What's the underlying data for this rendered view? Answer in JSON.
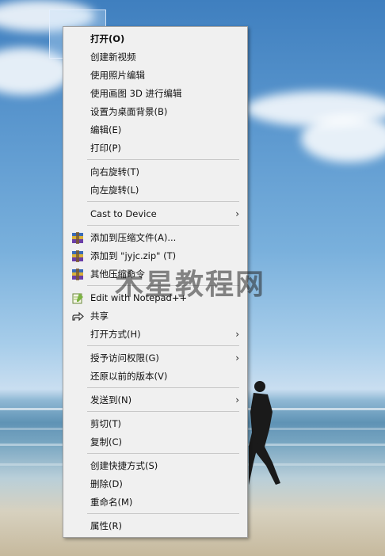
{
  "menu": {
    "items": [
      {
        "label": "打开(O)",
        "bold": true
      },
      {
        "label": "创建新视频"
      },
      {
        "label": "使用照片编辑"
      },
      {
        "label": "使用画图 3D 进行编辑"
      },
      {
        "label": "设置为桌面背景(B)"
      },
      {
        "label": "编辑(E)"
      },
      {
        "label": "打印(P)"
      },
      {
        "label": "向右旋转(T)"
      },
      {
        "label": "向左旋转(L)"
      },
      {
        "label": "Cast to Device"
      },
      {
        "label": "添加到压缩文件(A)..."
      },
      {
        "label": "添加到 \"jyjc.zip\" (T)"
      },
      {
        "label": "其他压缩命令"
      },
      {
        "label": "Edit with Notepad++"
      },
      {
        "label": "共享"
      },
      {
        "label": "打开方式(H)"
      },
      {
        "label": "授予访问权限(G)"
      },
      {
        "label": "还原以前的版本(V)"
      },
      {
        "label": "发送到(N)"
      },
      {
        "label": "剪切(T)"
      },
      {
        "label": "复制(C)"
      },
      {
        "label": "创建快捷方式(S)"
      },
      {
        "label": "删除(D)"
      },
      {
        "label": "重命名(M)"
      },
      {
        "label": "属性(R)"
      }
    ],
    "submenu_arrow": "›"
  },
  "watermark": "木星教程网",
  "icons": {
    "archive": "winrar-archive-icon",
    "notepad": "notepad-plus-plus-icon",
    "share": "share-icon"
  }
}
